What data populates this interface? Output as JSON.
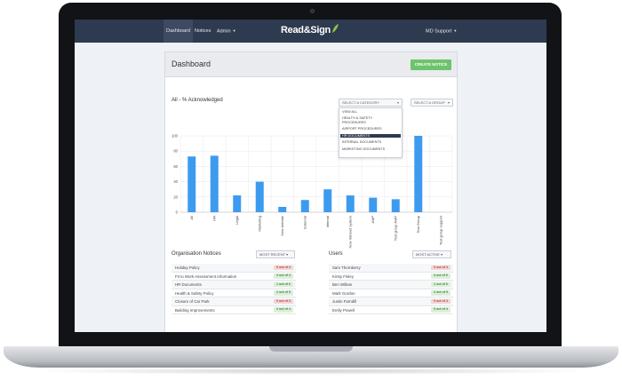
{
  "nav": {
    "items": [
      "Dashboard",
      "Notices",
      "Admin"
    ],
    "logo": "Read&Sign",
    "user": "MD Support"
  },
  "panel": {
    "title": "Dashboard",
    "create_button": "CREATE NOTICE"
  },
  "chart_section": {
    "title": "All - % Acknowledged",
    "category_select": "SELECT A CATEGORY",
    "group_select": "SELECT A GROUP",
    "category_options": [
      "VIEW ALL",
      "HEALTH & SAFETY",
      "PROCEDURES",
      "AIRPORT PROCEDURES",
      "HR DOCUMENTS",
      "INTERNAL DOCUMENTS",
      "MARKETING DOCUMENTS"
    ],
    "selected_option": "HR DOCUMENTS"
  },
  "chart_data": {
    "type": "bar",
    "categories": [
      "All",
      "HR",
      "Legal",
      "Marketing",
      "New website",
      "External",
      "Internal",
      "New Intranet system",
      "AMP",
      "Test group AMP",
      "Test Group",
      "Test group support"
    ],
    "values": [
      73,
      74,
      22,
      40,
      7,
      16,
      30,
      22,
      19,
      17,
      100,
      0
    ],
    "ylim": [
      0,
      100
    ],
    "yticks": [
      0,
      20,
      40,
      60,
      80,
      100
    ],
    "bar_color": "#3d9bef",
    "grid": true
  },
  "org_notices": {
    "title": "Organisation Notices",
    "filter": "MOST RECENT",
    "rows": [
      {
        "label": "Holiday Policy",
        "badge": "0 out of 3",
        "status": "red"
      },
      {
        "label": "Fit to Work Assessment Information",
        "badge": "4 out of 4",
        "status": "green"
      },
      {
        "label": "HR Documents",
        "badge": "1 out of 6",
        "status": "green"
      },
      {
        "label": "Health & Safety Policy",
        "badge": "2 out of 5",
        "status": "green"
      },
      {
        "label": "Closure of Car Park",
        "badge": "0 out of 3",
        "status": "red"
      },
      {
        "label": "Building Improvements",
        "badge": "4 out of 4",
        "status": "green"
      }
    ]
  },
  "users": {
    "title": "Users",
    "filter": "MOST ACTIVE",
    "rows": [
      {
        "label": "Sam Thornberry",
        "badge": "0 out of 3",
        "status": "red"
      },
      {
        "label": "Kirsty Finley",
        "badge": "4 out of 6",
        "status": "green"
      },
      {
        "label": "Ben Wilkan",
        "badge": "1 out of 6",
        "status": "green"
      },
      {
        "label": "Mark Gordon",
        "badge": "2 out of 5",
        "status": "green"
      },
      {
        "label": "Justin Farndill",
        "badge": "0 out of 3",
        "status": "red"
      },
      {
        "label": "Emily Powell",
        "badge": "0 out of 4",
        "status": "green"
      }
    ]
  }
}
